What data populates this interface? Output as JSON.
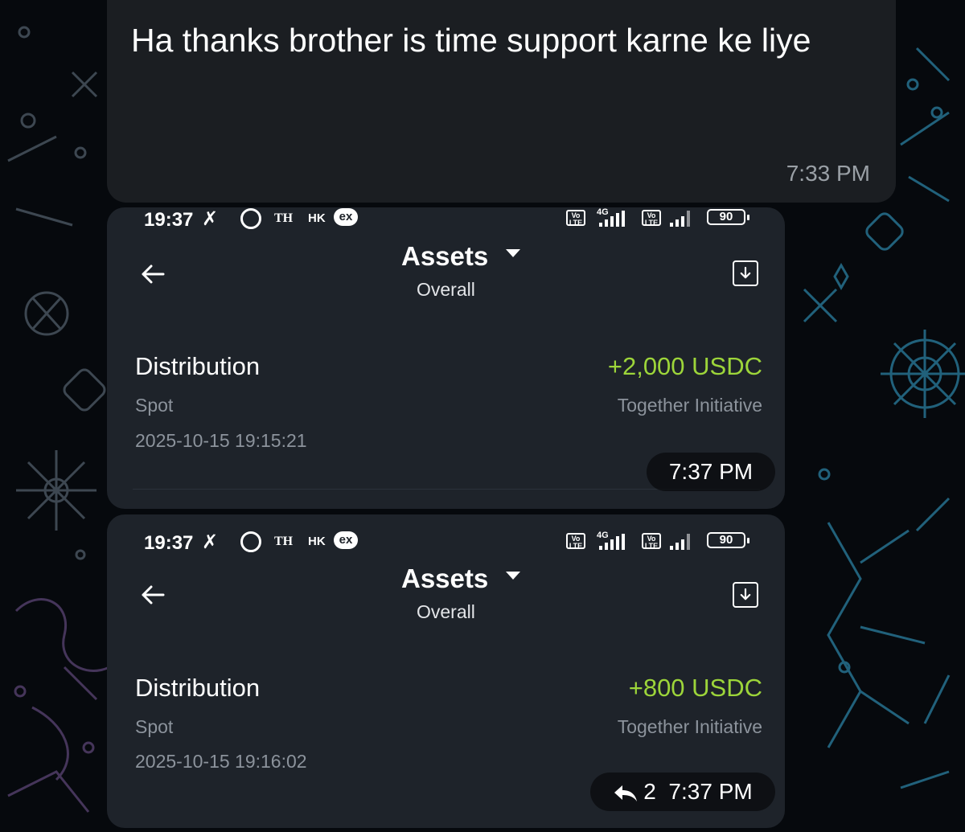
{
  "messages": [
    {
      "text": "Ha thanks brother is time support karne ke liye",
      "time": "7:33 PM"
    }
  ],
  "screenshots": [
    {
      "status_bar": {
        "time": "19:37",
        "th": "TH",
        "hk": "HK",
        "ex": "ex",
        "volte": "Vo LTE",
        "net": "4G",
        "battery": "90"
      },
      "header": {
        "title": "Assets",
        "subtitle": "Overall"
      },
      "entry": {
        "label": "Distribution",
        "amount": "+2,000 USDC",
        "type": "Spot",
        "source": "Together Initiative",
        "date": "2025-10-15 19:15:21"
      },
      "message_time": "7:37 PM"
    },
    {
      "status_bar": {
        "time": "19:37",
        "th": "TH",
        "hk": "HK",
        "ex": "ex",
        "volte": "Vo LTE",
        "net": "4G",
        "battery": "90"
      },
      "header": {
        "title": "Assets",
        "subtitle": "Overall"
      },
      "entry": {
        "label": "Distribution",
        "amount": "+800 USDC",
        "type": "Spot",
        "source": "Together Initiative",
        "date": "2025-10-15 19:16:02"
      },
      "message_time": "7:37 PM",
      "reply_count": "2"
    }
  ],
  "colors": {
    "bubble": "#1b1e22",
    "screenshot_bg": "#1e232a",
    "amount_green": "#9dd53a",
    "muted_text": "#8c939c",
    "wallpaper_doodle": "#2a7fa0"
  },
  "icons": {
    "back": "arrow-left-icon",
    "caret": "caret-down-icon",
    "download": "download-icon",
    "reply": "reply-arrow-icon",
    "alarm": "alarm-clock-icon",
    "mute": "vibrate-muted-icon"
  }
}
